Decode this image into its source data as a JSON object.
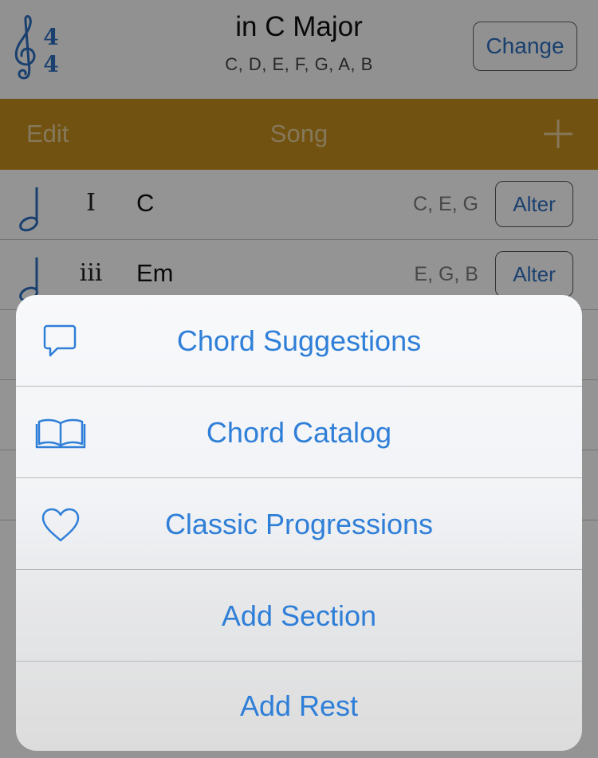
{
  "header": {
    "time_signature": {
      "top": "4",
      "bottom": "4"
    },
    "key_title": "in C Major",
    "key_notes": "C, D, E, F, G, A, B",
    "change_label": "Change"
  },
  "gold_bar": {
    "edit_label": "Edit",
    "title": "Song"
  },
  "chords": [
    {
      "numeral": "I",
      "name": "C",
      "notes": "C, E, G",
      "alter_label": "Alter"
    },
    {
      "numeral": "iii",
      "name": "Em",
      "notes": "E, G, B",
      "alter_label": "Alter"
    }
  ],
  "action_sheet": {
    "items": [
      {
        "label": "Chord Suggestions",
        "icon": "speech-bubble-icon"
      },
      {
        "label": "Chord Catalog",
        "icon": "book-icon"
      },
      {
        "label": "Classic Progressions",
        "icon": "heart-icon"
      },
      {
        "label": "Add Section",
        "icon": ""
      },
      {
        "label": "Add Rest",
        "icon": ""
      }
    ]
  },
  "colors": {
    "accent_blue": "#2f7fd8",
    "gold": "#c48d1d",
    "gold_text": "#e6cf9c"
  }
}
